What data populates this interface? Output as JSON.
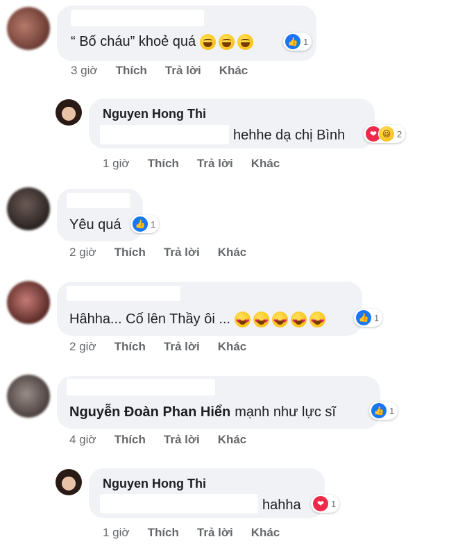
{
  "comments": [
    {
      "text": "“ Bố cháu” khoẻ quá",
      "emoji_count": 3,
      "reaction_count": "1",
      "time": "3 giờ",
      "like": "Thích",
      "reply": "Trả lời",
      "more": "Khác"
    },
    {
      "author": "Nguyen Hong Thi",
      "text": "hehhe dạ chị Bình",
      "reaction_count": "2",
      "time": "1 giờ",
      "like": "Thích",
      "reply": "Trả lời",
      "more": "Khác"
    },
    {
      "text": "Yêu quá",
      "reaction_count": "1",
      "time": "2 giờ",
      "like": "Thích",
      "reply": "Trả lời",
      "more": "Khác"
    },
    {
      "text": "Hâhha... Cố lên Thầy ôi ...",
      "emoji_count": 5,
      "reaction_count": "1",
      "time": "2 giờ",
      "like": "Thích",
      "reply": "Trả lời",
      "more": "Khác"
    },
    {
      "mention": "Nguyễn Đoàn Phan Hiển",
      "text": "mạnh như lực sĩ",
      "reaction_count": "1",
      "time": "4 giờ",
      "like": "Thích",
      "reply": "Trả lời",
      "more": "Khác"
    },
    {
      "author": "Nguyen Hong Thi",
      "text": "hahha",
      "reaction_count": "1",
      "time": "1 giờ",
      "like": "Thích",
      "reply": "Trả lời",
      "more": "Khác"
    }
  ],
  "colors": {
    "bubble": "#f0f2f5",
    "like": "#1877f2",
    "love": "#f0284a",
    "meta": "#65676b"
  }
}
